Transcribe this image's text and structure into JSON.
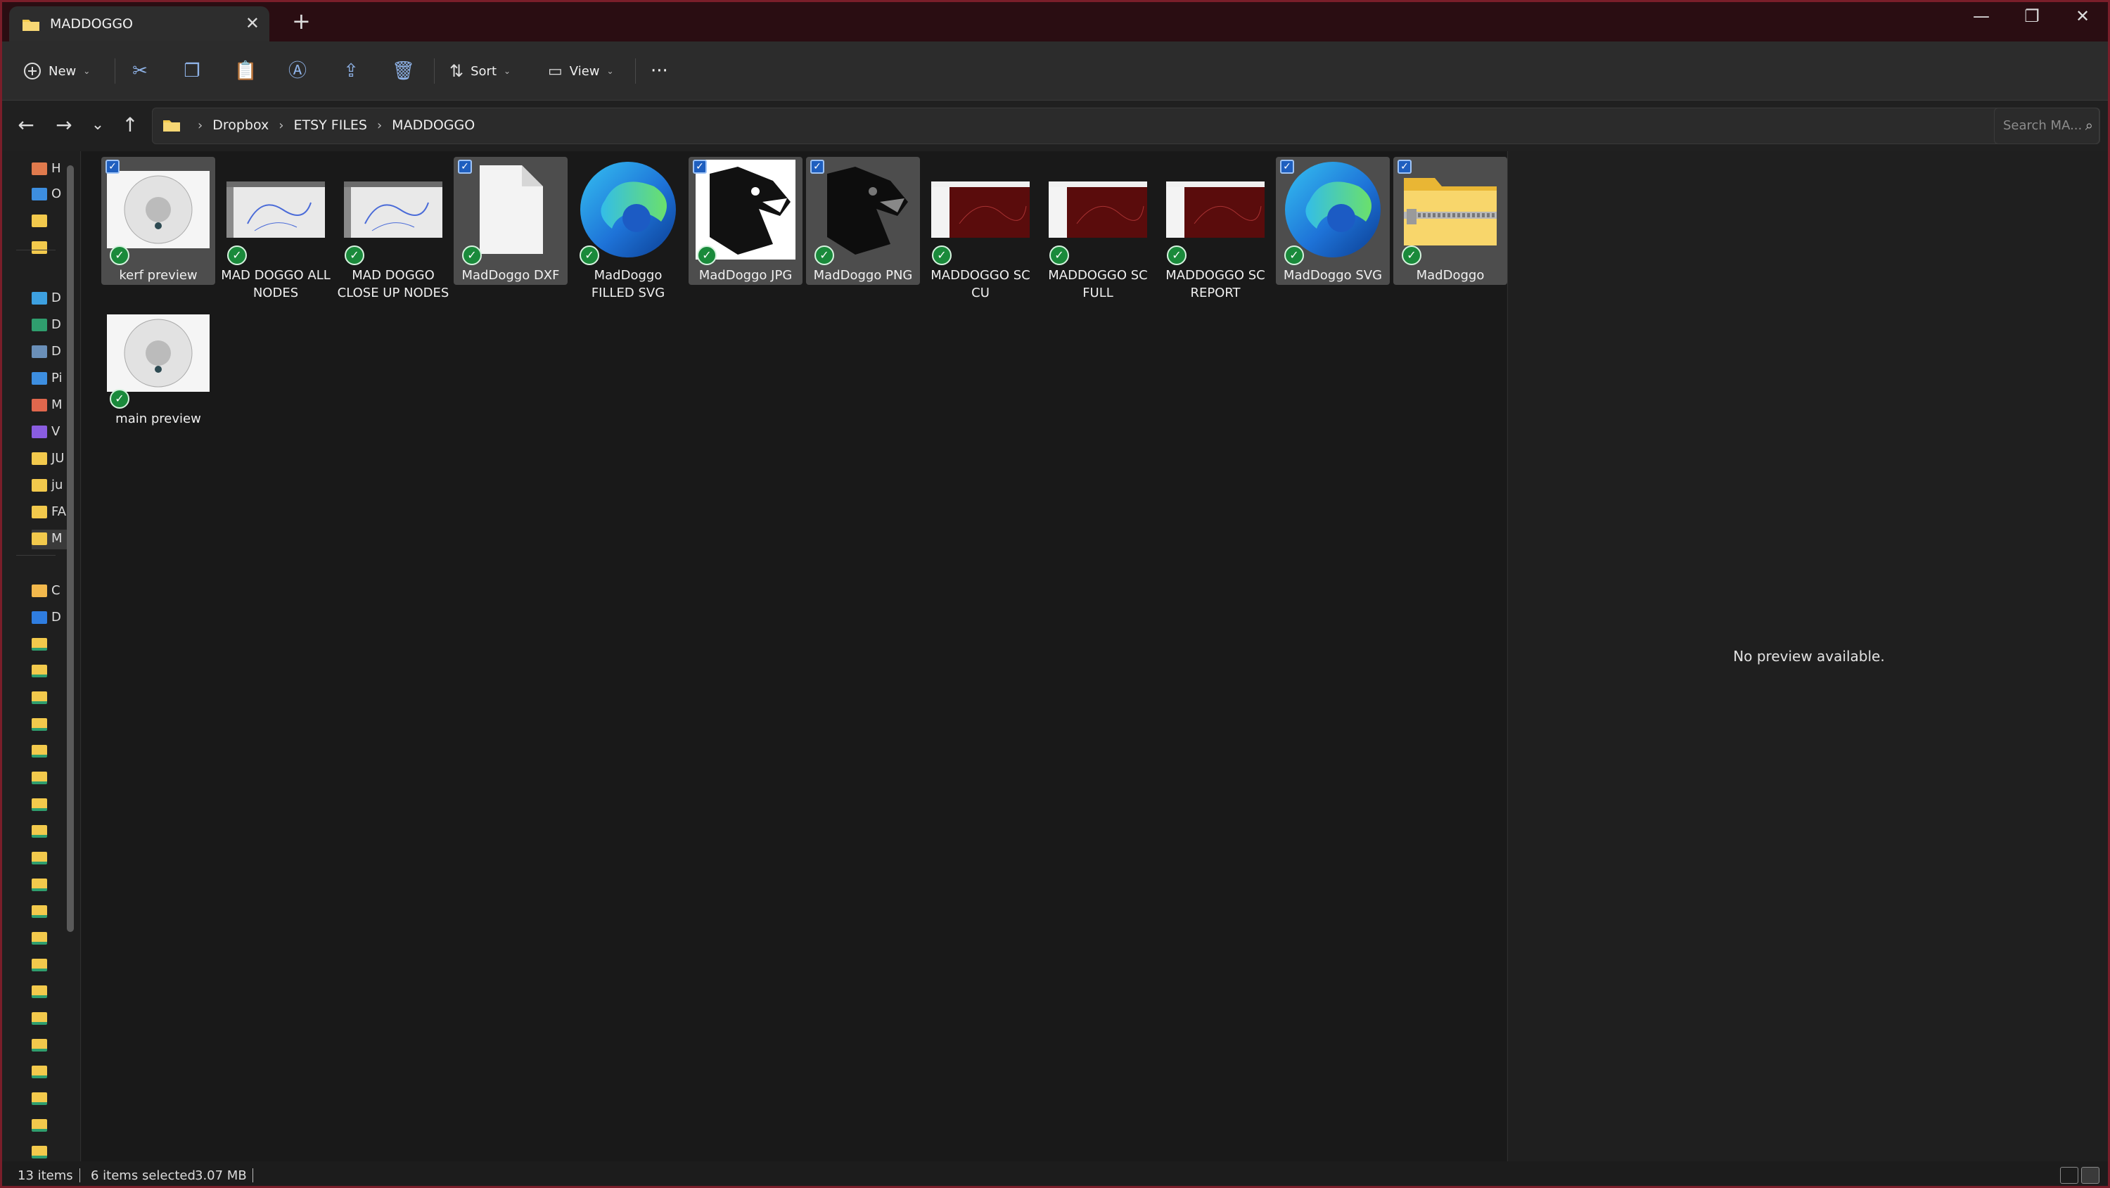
{
  "window": {
    "tab_title": "MADDOGGO",
    "new_tab_icon": "plus-icon",
    "minimize": "—",
    "restore": "❐",
    "close": "✕",
    "tab_close": "✕"
  },
  "toolbar": {
    "new_label": "New",
    "sort_label": "Sort",
    "view_label": "View",
    "more": "···"
  },
  "address": {
    "crumbs": [
      "Dropbox",
      "ETSY FILES",
      "MADDOGGO"
    ],
    "search_placeholder": "Search MA..."
  },
  "sidebar": {
    "items": [
      {
        "label": "H",
        "icon": "home-icon",
        "color": "#e07a4d"
      },
      {
        "label": "O",
        "icon": "onedrive-icon",
        "color": "#3d8ee0"
      },
      {
        "label": "",
        "icon": "folder-icon",
        "color": "#f2c94c"
      },
      {
        "label": "",
        "icon": "folder-icon",
        "color": "#f2c94c"
      },
      {
        "label": "D",
        "icon": "desktop-icon",
        "color": "#3da0e0"
      },
      {
        "label": "D",
        "icon": "downloads-icon",
        "color": "#2f9e6e"
      },
      {
        "label": "D",
        "icon": "documents-icon",
        "color": "#6a8fb8"
      },
      {
        "label": "Pi",
        "icon": "pictures-icon",
        "color": "#3d8ee0"
      },
      {
        "label": "M",
        "icon": "music-icon",
        "color": "#e0674d"
      },
      {
        "label": "V",
        "icon": "videos-icon",
        "color": "#8a5de0"
      },
      {
        "label": "JU",
        "icon": "folder-icon",
        "color": "#f2c94c"
      },
      {
        "label": "ju",
        "icon": "folder-icon",
        "color": "#f2c94c"
      },
      {
        "label": "FA",
        "icon": "folder-icon",
        "color": "#f2c94c"
      },
      {
        "label": "M",
        "icon": "folder-icon",
        "color": "#f2c94c"
      },
      {
        "label": "C",
        "icon": "drive-icon",
        "color": "#f2b84c"
      },
      {
        "label": "D",
        "icon": "dropbox-icon",
        "color": "#2f7de0"
      }
    ]
  },
  "files": [
    {
      "name": "kerf preview",
      "selected": true,
      "kind": "image-circle"
    },
    {
      "name": "MAD DOGGO ALL NODES",
      "selected": false,
      "kind": "screenshot-light"
    },
    {
      "name": "MAD DOGGO CLOSE UP NODES",
      "selected": false,
      "kind": "screenshot-light"
    },
    {
      "name": "MadDoggo DXF",
      "selected": true,
      "kind": "blank-doc"
    },
    {
      "name": "MadDoggo FILLED SVG",
      "selected": false,
      "kind": "edge"
    },
    {
      "name": "MadDoggo JPG",
      "selected": true,
      "kind": "dog-white"
    },
    {
      "name": "MadDoggo PNG",
      "selected": true,
      "kind": "dog-dark"
    },
    {
      "name": "MADDOGGO SC CU",
      "selected": false,
      "kind": "screenshot-red"
    },
    {
      "name": "MADDOGGO SC FULL",
      "selected": false,
      "kind": "screenshot-red"
    },
    {
      "name": "MADDOGGO SC REPORT",
      "selected": false,
      "kind": "screenshot-red"
    },
    {
      "name": "MadDoggo SVG",
      "selected": true,
      "kind": "edge"
    },
    {
      "name": "MadDoggo",
      "selected": true,
      "kind": "zip-folder"
    },
    {
      "name": "main preview",
      "selected": false,
      "kind": "image-circle"
    }
  ],
  "preview": {
    "message": "No preview available."
  },
  "status": {
    "count": "13 items",
    "selected": "6 items selected",
    "size": "3.07 MB"
  },
  "colors": {
    "accent": "#1f5fbf",
    "sync_green": "#1a8a3b",
    "frame": "#7a1e2a"
  }
}
